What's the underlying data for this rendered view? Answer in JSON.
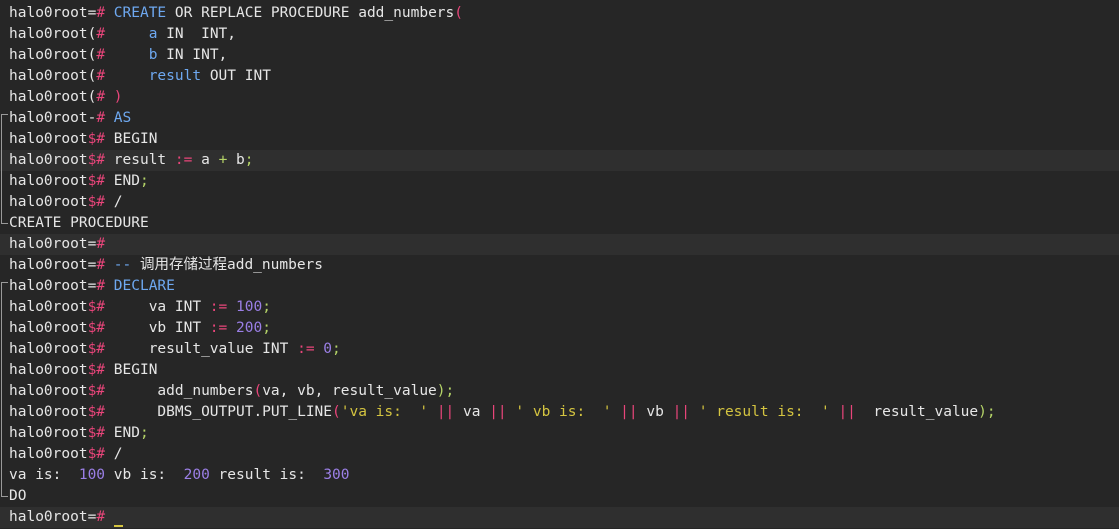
{
  "terminal": {
    "lines": [
      {
        "hl": false,
        "gutter": "",
        "segments": [
          {
            "t": "halo0root=",
            "c": "prompt"
          },
          {
            "t": "# ",
            "c": "sym"
          },
          {
            "t": "CREATE",
            "c": "kw"
          },
          {
            "t": " OR REPLACE PROCEDURE add_numbers",
            "c": "default"
          },
          {
            "t": "(",
            "c": "sym"
          }
        ]
      },
      {
        "hl": false,
        "gutter": "",
        "segments": [
          {
            "t": "halo0root(",
            "c": "prompt"
          },
          {
            "t": "#     ",
            "c": "sym"
          },
          {
            "t": "a",
            "c": "kw"
          },
          {
            "t": " IN  INT,",
            "c": "default"
          }
        ]
      },
      {
        "hl": false,
        "gutter": "",
        "segments": [
          {
            "t": "halo0root(",
            "c": "prompt"
          },
          {
            "t": "#     ",
            "c": "sym"
          },
          {
            "t": "b",
            "c": "kw"
          },
          {
            "t": " IN INT,",
            "c": "default"
          }
        ]
      },
      {
        "hl": false,
        "gutter": "",
        "segments": [
          {
            "t": "halo0root(",
            "c": "prompt"
          },
          {
            "t": "#     ",
            "c": "sym"
          },
          {
            "t": "result",
            "c": "kw"
          },
          {
            "t": " OUT INT",
            "c": "default"
          }
        ]
      },
      {
        "hl": false,
        "gutter": "",
        "segments": [
          {
            "t": "halo0root(",
            "c": "prompt"
          },
          {
            "t": "# )",
            "c": "sym"
          }
        ]
      },
      {
        "hl": false,
        "gutter": "start",
        "segments": [
          {
            "t": "halo0root-",
            "c": "prompt"
          },
          {
            "t": "# ",
            "c": "sym"
          },
          {
            "t": "AS",
            "c": "kw"
          }
        ]
      },
      {
        "hl": false,
        "gutter": "mid",
        "segments": [
          {
            "t": "halo0root",
            "c": "prompt"
          },
          {
            "t": "$# ",
            "c": "sym"
          },
          {
            "t": "BEGIN",
            "c": "default"
          }
        ]
      },
      {
        "hl": true,
        "gutter": "mid",
        "segments": [
          {
            "t": "halo0root",
            "c": "prompt"
          },
          {
            "t": "$# ",
            "c": "sym"
          },
          {
            "t": "result ",
            "c": "default"
          },
          {
            "t": ":=",
            "c": "sym"
          },
          {
            "t": " a ",
            "c": "default"
          },
          {
            "t": "+",
            "c": "green"
          },
          {
            "t": " b",
            "c": "default"
          },
          {
            "t": ";",
            "c": "green"
          }
        ]
      },
      {
        "hl": false,
        "gutter": "mid",
        "segments": [
          {
            "t": "halo0root",
            "c": "prompt"
          },
          {
            "t": "$# ",
            "c": "sym"
          },
          {
            "t": "END",
            "c": "default"
          },
          {
            "t": ";",
            "c": "green"
          }
        ]
      },
      {
        "hl": false,
        "gutter": "mid",
        "segments": [
          {
            "t": "halo0root",
            "c": "prompt"
          },
          {
            "t": "$# ",
            "c": "sym"
          },
          {
            "t": "/",
            "c": "default"
          }
        ]
      },
      {
        "hl": false,
        "gutter": "end",
        "segments": [
          {
            "t": "CREATE PROCEDURE",
            "c": "output"
          }
        ]
      },
      {
        "hl": true,
        "gutter": "",
        "segments": [
          {
            "t": "halo0root=",
            "c": "prompt"
          },
          {
            "t": "#",
            "c": "sym"
          }
        ]
      },
      {
        "hl": false,
        "gutter": "",
        "segments": [
          {
            "t": "halo0root=",
            "c": "prompt"
          },
          {
            "t": "# ",
            "c": "sym"
          },
          {
            "t": "--",
            "c": "comment"
          },
          {
            "t": " 调用存储过程add_numbers",
            "c": "default"
          }
        ]
      },
      {
        "hl": false,
        "gutter": "start",
        "segments": [
          {
            "t": "halo0root=",
            "c": "prompt"
          },
          {
            "t": "# ",
            "c": "sym"
          },
          {
            "t": "DECLARE",
            "c": "kw"
          }
        ]
      },
      {
        "hl": false,
        "gutter": "mid",
        "segments": [
          {
            "t": "halo0root",
            "c": "prompt"
          },
          {
            "t": "$#     ",
            "c": "sym"
          },
          {
            "t": "va INT ",
            "c": "default"
          },
          {
            "t": ":=",
            "c": "sym"
          },
          {
            "t": " ",
            "c": "default"
          },
          {
            "t": "100",
            "c": "num"
          },
          {
            "t": ";",
            "c": "green"
          }
        ]
      },
      {
        "hl": false,
        "gutter": "mid",
        "segments": [
          {
            "t": "halo0root",
            "c": "prompt"
          },
          {
            "t": "$#     ",
            "c": "sym"
          },
          {
            "t": "vb INT ",
            "c": "default"
          },
          {
            "t": ":=",
            "c": "sym"
          },
          {
            "t": " ",
            "c": "default"
          },
          {
            "t": "200",
            "c": "num"
          },
          {
            "t": ";",
            "c": "green"
          }
        ]
      },
      {
        "hl": false,
        "gutter": "mid",
        "segments": [
          {
            "t": "halo0root",
            "c": "prompt"
          },
          {
            "t": "$#     ",
            "c": "sym"
          },
          {
            "t": "result_value INT ",
            "c": "default"
          },
          {
            "t": ":=",
            "c": "sym"
          },
          {
            "t": " ",
            "c": "default"
          },
          {
            "t": "0",
            "c": "num"
          },
          {
            "t": ";",
            "c": "green"
          }
        ]
      },
      {
        "hl": false,
        "gutter": "mid",
        "segments": [
          {
            "t": "halo0root",
            "c": "prompt"
          },
          {
            "t": "$# ",
            "c": "sym"
          },
          {
            "t": "BEGIN",
            "c": "default"
          }
        ]
      },
      {
        "hl": false,
        "gutter": "mid",
        "segments": [
          {
            "t": "halo0root",
            "c": "prompt"
          },
          {
            "t": "$#      ",
            "c": "sym"
          },
          {
            "t": "add_numbers",
            "c": "default"
          },
          {
            "t": "(",
            "c": "sym"
          },
          {
            "t": "va, vb, result_value",
            "c": "default"
          },
          {
            "t": ");",
            "c": "green"
          }
        ]
      },
      {
        "hl": false,
        "gutter": "mid",
        "segments": [
          {
            "t": "halo0root",
            "c": "prompt"
          },
          {
            "t": "$#      ",
            "c": "sym"
          },
          {
            "t": "DBMS_OUTPUT.PUT_LINE",
            "c": "default"
          },
          {
            "t": "(",
            "c": "sym"
          },
          {
            "t": "'va is:  '",
            "c": "str"
          },
          {
            "t": " ",
            "c": "default"
          },
          {
            "t": "||",
            "c": "sym"
          },
          {
            "t": " va ",
            "c": "default"
          },
          {
            "t": "||",
            "c": "sym"
          },
          {
            "t": " ",
            "c": "default"
          },
          {
            "t": "' vb is:  '",
            "c": "str"
          },
          {
            "t": " ",
            "c": "default"
          },
          {
            "t": "||",
            "c": "sym"
          },
          {
            "t": " vb ",
            "c": "default"
          },
          {
            "t": "||",
            "c": "sym"
          },
          {
            "t": " ",
            "c": "default"
          },
          {
            "t": "' result is:  '",
            "c": "str"
          },
          {
            "t": " ",
            "c": "default"
          },
          {
            "t": "||",
            "c": "sym"
          },
          {
            "t": "  result_value",
            "c": "default"
          },
          {
            "t": ");",
            "c": "green"
          }
        ]
      },
      {
        "hl": false,
        "gutter": "mid",
        "segments": [
          {
            "t": "halo0root",
            "c": "prompt"
          },
          {
            "t": "$# ",
            "c": "sym"
          },
          {
            "t": "END",
            "c": "default"
          },
          {
            "t": ";",
            "c": "green"
          }
        ]
      },
      {
        "hl": false,
        "gutter": "mid",
        "segments": [
          {
            "t": "halo0root",
            "c": "prompt"
          },
          {
            "t": "$# ",
            "c": "sym"
          },
          {
            "t": "/",
            "c": "default"
          }
        ]
      },
      {
        "hl": false,
        "gutter": "mid",
        "segments": [
          {
            "t": "va is:  ",
            "c": "output"
          },
          {
            "t": "100",
            "c": "num"
          },
          {
            "t": " vb is:  ",
            "c": "output"
          },
          {
            "t": "200",
            "c": "num"
          },
          {
            "t": " result is:  ",
            "c": "output"
          },
          {
            "t": "300",
            "c": "num"
          }
        ]
      },
      {
        "hl": false,
        "gutter": "end",
        "segments": [
          {
            "t": "DO",
            "c": "output"
          }
        ]
      },
      {
        "hl": true,
        "gutter": "",
        "cursor": true,
        "segments": [
          {
            "t": "halo0root=",
            "c": "prompt"
          },
          {
            "t": "# ",
            "c": "sym"
          }
        ]
      }
    ]
  },
  "colors": {
    "background": "#262626",
    "highlight_line": "#2f2f2f",
    "prompt_symbol": "#e8457a",
    "keyword": "#6ea8f0",
    "number": "#9b7fe6",
    "string": "#d4c440",
    "punctuation": "#b5d468"
  }
}
